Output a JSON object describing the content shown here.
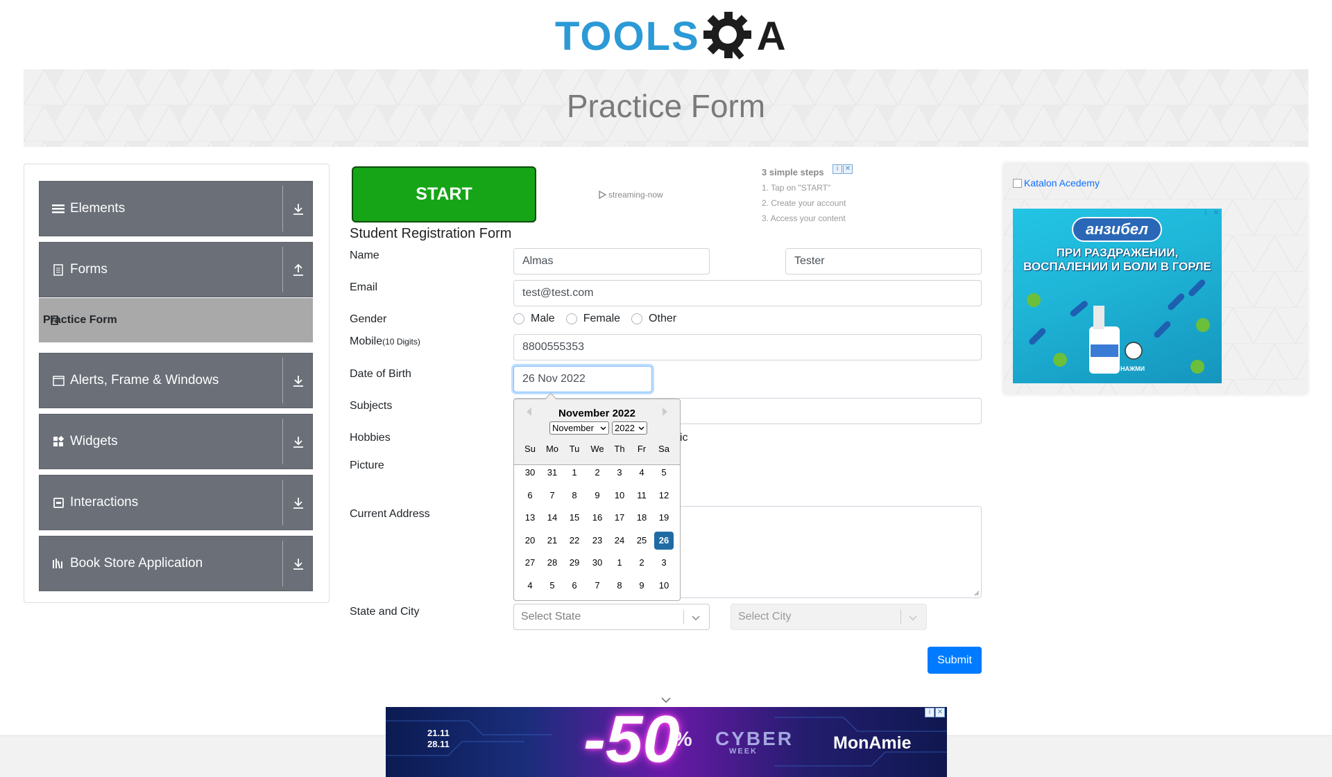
{
  "header": {
    "logo_left": "TOOLS",
    "logo_right": "A",
    "page_title": "Practice Form"
  },
  "sidebar": {
    "groups": [
      {
        "label": "Elements",
        "icon": "list-icon",
        "arrow": "download-icon"
      },
      {
        "label": "Forms",
        "icon": "document-icon",
        "arrow": "upload-icon"
      },
      {
        "label": "Alerts, Frame & Windows",
        "icon": "window-icon",
        "arrow": "download-icon"
      },
      {
        "label": "Widgets",
        "icon": "widgets-icon",
        "arrow": "download-icon"
      },
      {
        "label": "Interactions",
        "icon": "interactions-icon",
        "arrow": "download-icon"
      },
      {
        "label": "Book Store Application",
        "icon": "books-icon",
        "arrow": "download-icon"
      }
    ],
    "active_item": "Practice Form"
  },
  "ads": {
    "start_button": "START",
    "streaming": "streaming-now",
    "steps_title": "3 simple steps",
    "steps": [
      "1. Tap on \"START\"",
      "2. Create your account",
      "3. Access your content"
    ],
    "katalon_alt": "Katalon Acedemy",
    "med_brand": "анзибел",
    "med_text_line1": "ПРИ РАЗДРАЖЕНИИ,",
    "med_text_line2": "ВОСПАЛЕНИИ И БОЛИ В ГОРЛЕ",
    "med_tap": "НАЖМИ",
    "bottom_dates_1": "21.11",
    "bottom_dates_2": "28.11",
    "bottom_big": "-50",
    "bottom_pct": "%",
    "bottom_cyber": "CYBER",
    "bottom_week": "WEEK",
    "bottom_brand": "MonAmie"
  },
  "form": {
    "title": "Student Registration Form",
    "name_label": "Name",
    "first_name": "Almas",
    "last_name": "Tester",
    "email_label": "Email",
    "email": "test@test.com",
    "gender_label": "Gender",
    "gender_options": [
      "Male",
      "Female",
      "Other"
    ],
    "mobile_label": "Mobile",
    "mobile_hint": "(10 Digits)",
    "mobile": "8800555353",
    "dob_label": "Date of Birth",
    "dob": "26 Nov 2022",
    "subjects_label": "Subjects",
    "hobbies_label": "Hobbies",
    "hobbies_partial": "ic",
    "picture_label": "Picture",
    "address_label": "Current Address",
    "state_city_label": "State and City",
    "state_placeholder": "Select State",
    "city_placeholder": "Select City",
    "submit": "Submit"
  },
  "datepicker": {
    "month_title": "November 2022",
    "month_select": "November",
    "year_select": "2022",
    "weekdays": [
      "Su",
      "Mo",
      "Tu",
      "We",
      "Th",
      "Fr",
      "Sa"
    ],
    "weeks": [
      [
        "30",
        "31",
        "1",
        "2",
        "3",
        "4",
        "5"
      ],
      [
        "6",
        "7",
        "8",
        "9",
        "10",
        "11",
        "12"
      ],
      [
        "13",
        "14",
        "15",
        "16",
        "17",
        "18",
        "19"
      ],
      [
        "20",
        "21",
        "22",
        "23",
        "24",
        "25",
        "26"
      ],
      [
        "27",
        "28",
        "29",
        "30",
        "1",
        "2",
        "3"
      ],
      [
        "4",
        "5",
        "6",
        "7",
        "8",
        "9",
        "10"
      ]
    ],
    "selected_day": "26"
  },
  "colors": {
    "sidebar_group": "#6a6f78",
    "active_item": "#a9a9a9",
    "primary": "#007bff",
    "start_green": "#16a517",
    "datepicker_selected": "#216ba5"
  }
}
